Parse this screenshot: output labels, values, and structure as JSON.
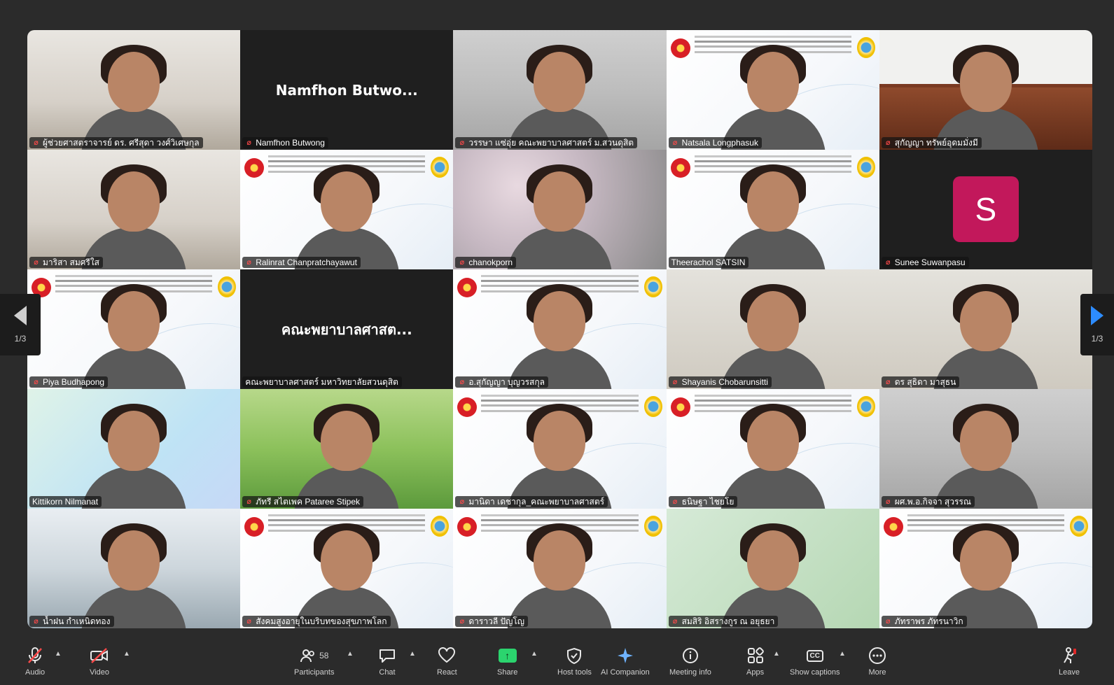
{
  "tiles": [
    {
      "name": "ผู้ช่วยศาสตราจารย์ ดร. ศรีสุดา วงศ์วิเศษกุล",
      "muted": true,
      "bg": "room"
    },
    {
      "name": "Namfhon Butwong",
      "muted": true,
      "bg": "dark",
      "center": "Namfhon  Butwo..."
    },
    {
      "name": "วรรษา  แซ่อุ่ย คณะพยาบาลศาสตร์ ม.สวนดุสิต",
      "muted": true,
      "bg": "office"
    },
    {
      "name": "Natsala Longphasuk",
      "muted": true,
      "bg": "slide"
    },
    {
      "name": "สุกัญญา  ทรัพย์อุดมมั่งมี",
      "muted": true,
      "bg": "shelf"
    },
    {
      "name": "มาริสา สมศรีใส",
      "muted": true,
      "bg": "room"
    },
    {
      "name": "Ralinrat Chanpratchayawut",
      "muted": true,
      "bg": "slide"
    },
    {
      "name": "chanokporn",
      "muted": true,
      "bg": "blossom"
    },
    {
      "name": "Theerachol SATSIN",
      "muted": false,
      "bg": "slide"
    },
    {
      "name": "Sunee Suwanpasu",
      "muted": true,
      "bg": "dark",
      "avatar": "S"
    },
    {
      "name": "Piya Budhapong",
      "muted": true,
      "bg": "slide"
    },
    {
      "name": "คณะพยาบาลศาสตร์ มหาวิทยาลัยสวนดุสิต",
      "muted": false,
      "bg": "dark",
      "center": "คณะพยาบาลศาสต...",
      "active": true
    },
    {
      "name": "อ.สุกัญญา บุญวรสกุล",
      "muted": true,
      "bg": "slide"
    },
    {
      "name": "Shayanis Chobarunsitti",
      "muted": true,
      "bg": "wall"
    },
    {
      "name": "ดร  สุธิดา มาสุธน",
      "muted": true,
      "bg": "wall"
    },
    {
      "name": "Kittikorn Nilmanat",
      "muted": false,
      "bg": "teal"
    },
    {
      "name": "ภัทรี สไตเพค Pataree Stipek",
      "muted": true,
      "bg": "green"
    },
    {
      "name": "มานิดา เดชากุล_คณะพยาบาลศาสตร์",
      "muted": true,
      "bg": "slide"
    },
    {
      "name": "ธนิษฐา  ไชยโย",
      "muted": true,
      "bg": "slide"
    },
    {
      "name": "ผศ.พ.อ.กิจจา สุวรรณ",
      "muted": true,
      "bg": "office"
    },
    {
      "name": "น้ำฝน กำเหนิดทอง",
      "muted": true,
      "bg": "hospital"
    },
    {
      "name": "สังคมสูงอายุในบริบทของสุขภาพโลก",
      "muted": true,
      "bg": "slide"
    },
    {
      "name": "ดาราวลี ปัญโญ",
      "muted": true,
      "bg": "slide"
    },
    {
      "name": "สมสิริ อิสรางกูร ณ อยุธยา",
      "muted": true,
      "bg": "mint"
    },
    {
      "name": "ภัทราพร ภัทรนาวิก",
      "muted": true,
      "bg": "slide"
    }
  ],
  "nav": {
    "left_page": "1/3",
    "right_page": "1/3"
  },
  "toolbar": {
    "audio": "Audio",
    "video": "Video",
    "participants": "Participants",
    "participants_count": "58",
    "chat": "Chat",
    "react": "React",
    "share": "Share",
    "host_tools": "Host tools",
    "ai_companion": "AI Companion",
    "meeting_info": "Meeting info",
    "apps": "Apps",
    "show_captions": "Show captions",
    "more": "More",
    "leave": "Leave"
  },
  "colors": {
    "active_speaker": "#23d18b",
    "avatar_bg": "#c2185b",
    "mute": "#ff4a4a",
    "share": "#2bd46e",
    "nav_accent": "#2d8cff"
  }
}
